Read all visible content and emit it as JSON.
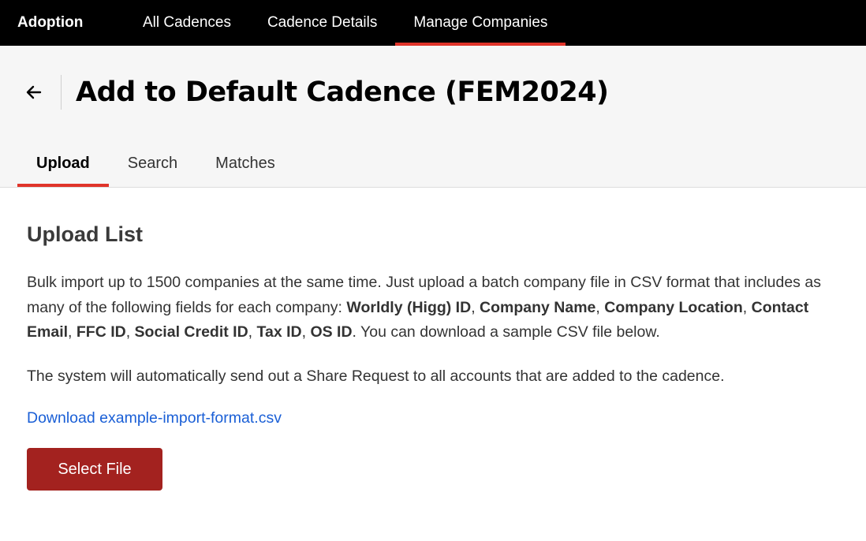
{
  "topnav": {
    "brand": "Adoption",
    "items": [
      {
        "label": "All Cadences"
      },
      {
        "label": "Cadence Details"
      },
      {
        "label": "Manage Companies"
      }
    ],
    "active_index": 2,
    "accent_color": "#e0342a"
  },
  "header": {
    "back_icon": "arrow-left-icon",
    "title": "Add to Default Cadence (FEM2024)",
    "tabs": [
      {
        "label": "Upload"
      },
      {
        "label": "Search"
      },
      {
        "label": "Matches"
      }
    ],
    "active_tab": 0
  },
  "main": {
    "section_title": "Upload List",
    "intro": {
      "p1": "Bulk import up to 1500 companies at the same time. Just upload a batch company file in CSV format that includes as many of the following fields for each company: ",
      "fields": [
        "Worldly (Higg) ID",
        "Company Name",
        "Company Location",
        "Contact Email",
        "FFC ID",
        "Social Credit ID",
        "Tax ID",
        "OS ID"
      ],
      "sep": ", ",
      "p2": ". You can download a sample CSV file below."
    },
    "notice": "The system will automatically send out a Share Request to all accounts that are added to the cadence.",
    "download_link": "Download example-import-format.csv",
    "select_button": "Select File",
    "button_color": "#a3221f",
    "link_color": "#1a5fd6"
  }
}
